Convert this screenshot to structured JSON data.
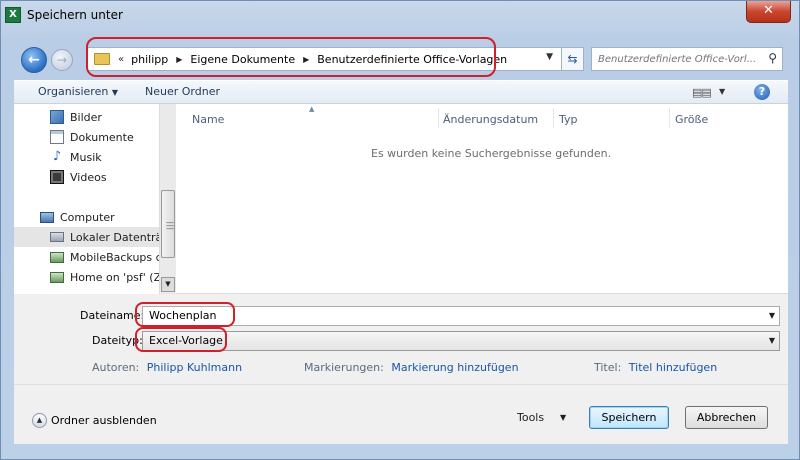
{
  "window": {
    "title": "Speichern unter",
    "app_icon_letter": "X",
    "close_label": "✕"
  },
  "navigation": {
    "address_prefix": "«",
    "breadcrumbs": [
      "philipp",
      "Eigene Dokumente",
      "Benutzerdefinierte Office-Vorlagen"
    ],
    "search_placeholder": "Benutzerdefinierte Office-Vorl..."
  },
  "toolbar": {
    "organize_label": "Organisieren",
    "new_folder_label": "Neuer Ordner"
  },
  "nav_pane": {
    "items": [
      {
        "label": "Bilder",
        "icon": "pictures-icon"
      },
      {
        "label": "Dokumente",
        "icon": "documents-icon"
      },
      {
        "label": "Musik",
        "icon": "music-icon"
      },
      {
        "label": "Videos",
        "icon": "videos-icon"
      },
      {
        "label": "Computer",
        "icon": "computer-icon"
      },
      {
        "label": "Lokaler Datenträg",
        "icon": "drive-icon"
      },
      {
        "label": "MobileBackups c",
        "icon": "network-drive-icon"
      },
      {
        "label": "Home on 'psf' (Z",
        "icon": "network-drive-icon"
      }
    ]
  },
  "file_list": {
    "columns": [
      "Name",
      "Änderungsdatum",
      "Typ",
      "Größe"
    ],
    "empty_message": "Es wurden keine Suchergebnisse gefunden."
  },
  "form": {
    "filename_label": "Dateiname:",
    "filename_value": "Wochenplan",
    "filetype_label": "Dateityp:",
    "filetype_value": "Excel-Vorlage",
    "authors_label": "Autoren:",
    "authors_value": "Philipp Kuhlmann",
    "tags_label": "Markierungen:",
    "tags_value": "Markierung hinzufügen",
    "title_label": "Titel:",
    "title_value": "Titel hinzufügen"
  },
  "footer": {
    "hide_folders_label": "Ordner ausblenden",
    "tools_label": "Tools",
    "save_label": "Speichern",
    "cancel_label": "Abbrechen"
  }
}
